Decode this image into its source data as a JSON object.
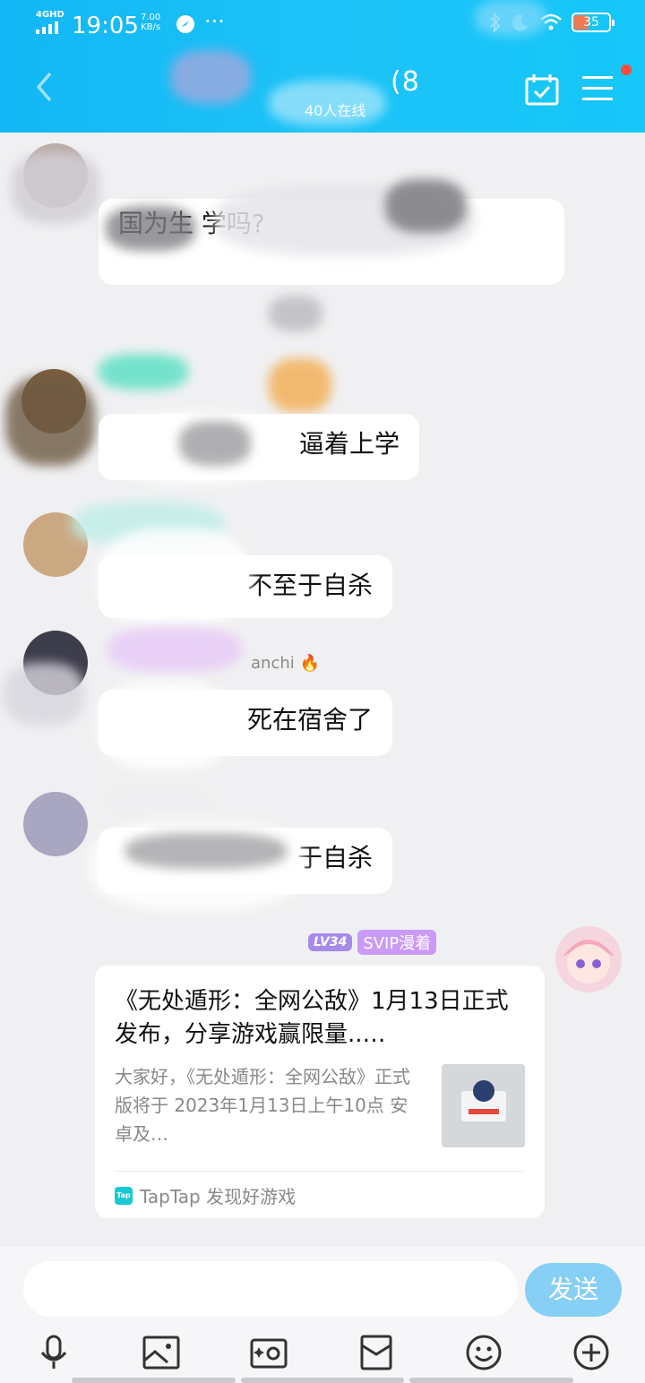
{
  "status_bar": {
    "network": "4GHD",
    "time": "19:05",
    "speed_value": "7.00",
    "speed_unit": "KB/s",
    "more": "···",
    "battery": "35"
  },
  "header": {
    "title": "(8",
    "subtitle": "40人在线"
  },
  "messages": [
    {
      "text": "国为生 学吗?"
    },
    {
      "text": "逼着上学"
    },
    {
      "text": "不至于自杀"
    },
    {
      "nick": "anchi",
      "nick_emoji": "🔥",
      "text": "死在宿舍了"
    },
    {
      "text": "于自杀"
    }
  ],
  "self_message": {
    "level_badge": "LV34",
    "svip_badge": "SVIP漫着",
    "card": {
      "title": "《无处遁形：全网公敌》1月13日正式发布，分享游戏赢限量..…",
      "description": "大家好，《无处遁形：全网公敌》正式版将于 2023年1月13日上午10点 安卓及…",
      "source": "TapTap 发现好游戏",
      "source_logo": "Tap"
    }
  },
  "input": {
    "placeholder": "",
    "send_label": "发送"
  },
  "toolbar": {
    "icons": [
      "microphone-icon",
      "picture-icon",
      "camera-icon",
      "red-packet-icon",
      "emoji-icon",
      "plus-icon"
    ]
  }
}
